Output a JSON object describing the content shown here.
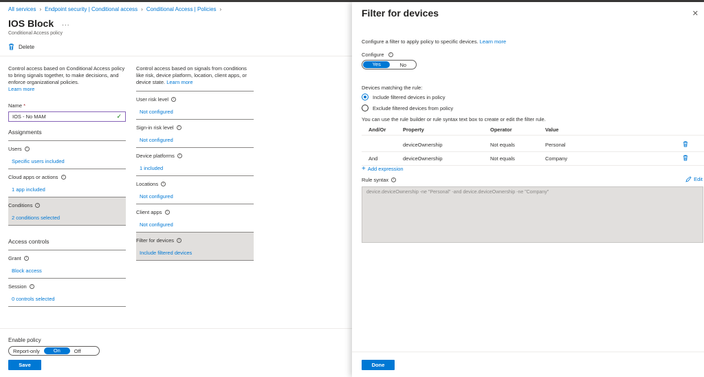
{
  "breadcrumb": [
    "All services",
    "Endpoint security | Conditional access",
    "Conditional Access | Policies"
  ],
  "policy": {
    "title": "IOS Block",
    "more": "...",
    "subtitle": "Conditional Access policy",
    "delete_label": "Delete"
  },
  "col1": {
    "description": "Control access based on Conditional Access policy to bring signals together, to make decisions, and enforce organizational policies.",
    "learn_more": "Learn more",
    "name_label": "Name",
    "name_required": "*",
    "name_value": "IOS - No MAM",
    "assignments_head": "Assignments",
    "users_label": "Users",
    "users_value": "Specific users included",
    "cloud_label": "Cloud apps or actions",
    "cloud_value": "1 app included",
    "conditions_label": "Conditions",
    "conditions_value": "2 conditions selected",
    "access_head": "Access controls",
    "grant_label": "Grant",
    "grant_value": "Block access",
    "session_label": "Session",
    "session_value": "0 controls selected"
  },
  "col2": {
    "description": "Control access based on signals from conditions like risk, device platform, location, client apps, or device state.",
    "learn_more": "Learn more",
    "items": [
      {
        "label": "User risk level",
        "value": "Not configured"
      },
      {
        "label": "Sign-in risk level",
        "value": "Not configured"
      },
      {
        "label": "Device platforms",
        "value": "1 included"
      },
      {
        "label": "Locations",
        "value": "Not configured"
      },
      {
        "label": "Client apps",
        "value": "Not configured"
      },
      {
        "label": "Filter for devices",
        "value": "Include filtered devices"
      }
    ]
  },
  "enable": {
    "label": "Enable policy",
    "options": [
      "Report-only",
      "On",
      "Off"
    ],
    "save": "Save"
  },
  "panel": {
    "title": "Filter for devices",
    "intro": "Configure a filter to apply policy to specific devices.",
    "learn_more": "Learn more",
    "configure_label": "Configure",
    "yes": "Yes",
    "no": "No",
    "matching_label": "Devices matching the rule:",
    "radio_include": "Include filtered devices in policy",
    "radio_exclude": "Exclude filtered devices from policy",
    "hint": "You can use the rule builder or rule syntax text box to create or edit the filter rule.",
    "columns": [
      "And/Or",
      "Property",
      "Operator",
      "Value"
    ],
    "rows": [
      {
        "andor": "",
        "property": "deviceOwnership",
        "operator": "Not equals",
        "value": "Personal"
      },
      {
        "andor": "And",
        "property": "deviceOwnership",
        "operator": "Not equals",
        "value": "Company"
      }
    ],
    "add_expression": "Add expression",
    "rule_syntax_label": "Rule syntax",
    "edit_label": "Edit",
    "rule_syntax": "device.deviceOwnership -ne \"Personal\" -and device.deviceOwnership -ne \"Company\"",
    "done": "Done"
  },
  "colors": {
    "accent": "#0078d4",
    "selected_bg": "#e1dfdd",
    "success": "#107c10"
  }
}
